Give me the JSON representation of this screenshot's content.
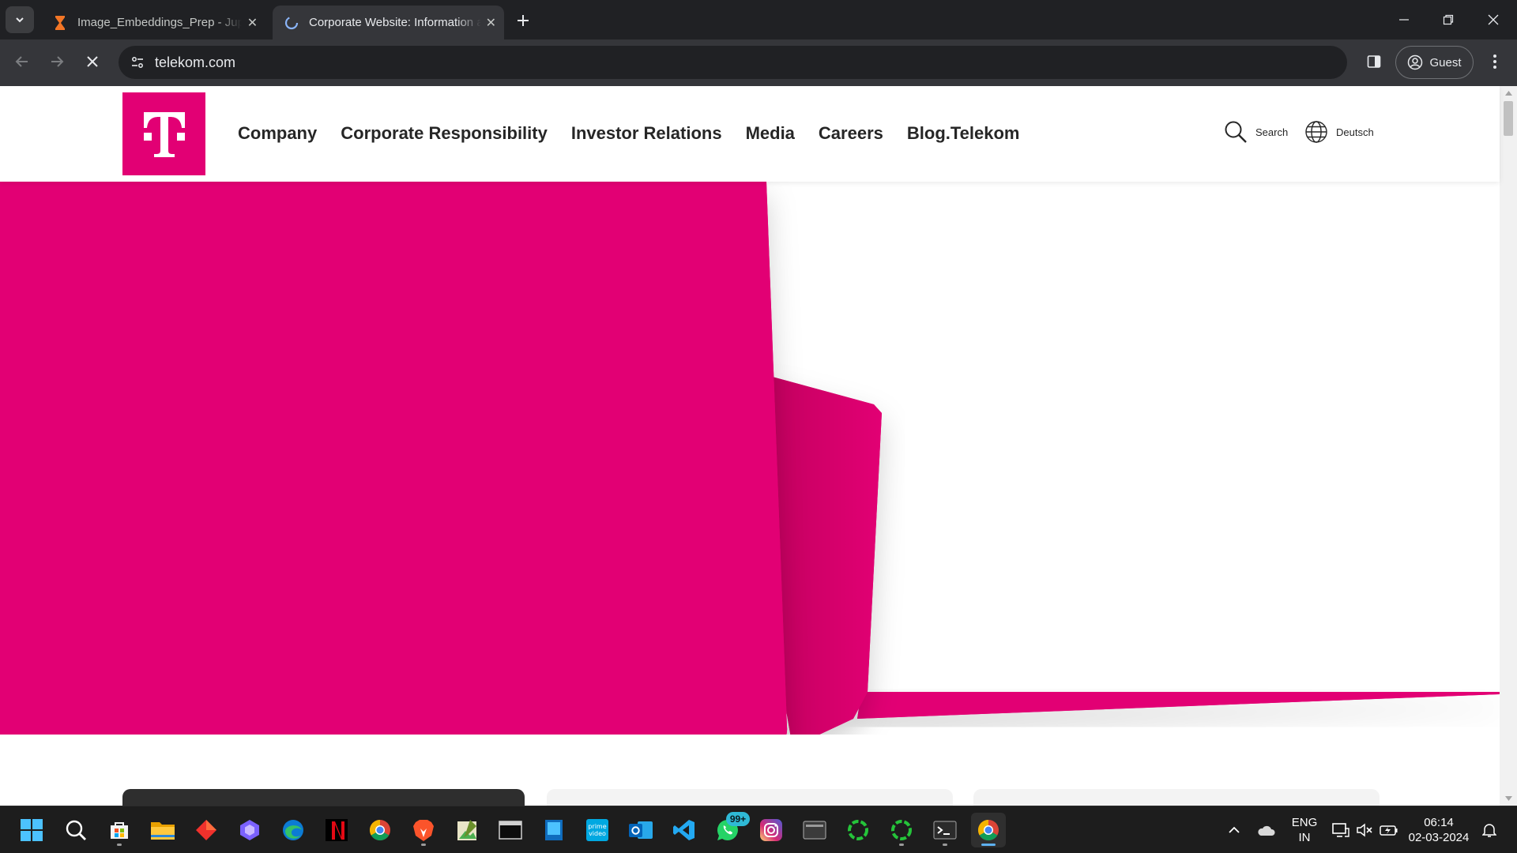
{
  "browser": {
    "tabs": [
      {
        "title": "Image_Embeddings_Prep - Jupyter Notebook",
        "favicon": "hourglass-icon",
        "active": false
      },
      {
        "title": "Corporate Website: Information about Deutsche Telekom",
        "favicon": "loading-spinner-icon",
        "active": true
      }
    ],
    "address": "telekom.com",
    "profile_label": "Guest",
    "loading": true
  },
  "site": {
    "brand_color": "#e20074",
    "logo_label": "T",
    "nav": [
      "Company",
      "Corporate Responsibility",
      "Investor Relations",
      "Media",
      "Careers",
      "Blog.Telekom"
    ],
    "search_label": "Search",
    "language_label": "Deutsch"
  },
  "taskbar": {
    "apps": [
      "start",
      "search",
      "microsoft-store",
      "file-explorer",
      "app-red-diamond",
      "copilot",
      "edge",
      "netflix",
      "chrome",
      "brave",
      "image-editor",
      "terminal-window",
      "windows-app",
      "prime-video",
      "outlook",
      "vscode",
      "whatsapp",
      "instagram",
      "media-player",
      "loader-app-1",
      "loader-app-2",
      "windows-terminal",
      "chrome-active"
    ],
    "whatsapp_badge": "99+",
    "language": "ENG",
    "region": "IN",
    "time": "06:14",
    "date": "02-03-2024"
  }
}
